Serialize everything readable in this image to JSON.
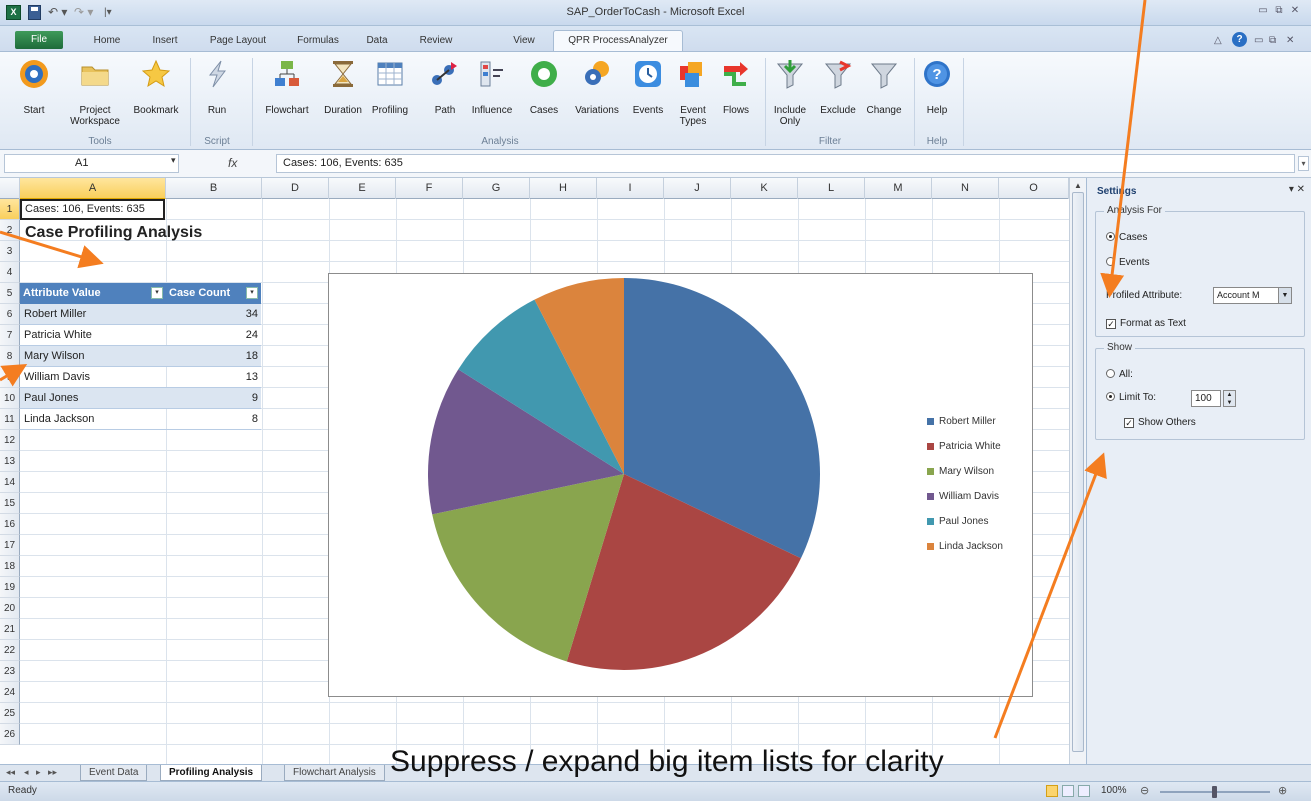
{
  "window": {
    "title": "SAP_OrderToCash - Microsoft Excel",
    "app_icon_glyph": "X"
  },
  "tabs": [
    "File",
    "Home",
    "Insert",
    "Page Layout",
    "Formulas",
    "Data",
    "Review",
    "View",
    "QPR ProcessAnalyzer"
  ],
  "ribbon": {
    "tools": {
      "group": "Tools",
      "buttons": [
        {
          "label": "Start",
          "icon": "start-icon"
        },
        {
          "label": "Project Workspace",
          "icon": "folder-icon"
        },
        {
          "label": "Bookmark",
          "icon": "star-icon"
        }
      ]
    },
    "script": {
      "group": "Script",
      "buttons": [
        {
          "label": "Run",
          "icon": "run-icon"
        }
      ]
    },
    "analysis": {
      "group": "Analysis",
      "buttons": [
        {
          "label": "Flowchart",
          "icon": "flowchart-icon"
        },
        {
          "label": "Duration",
          "icon": "hourglass-icon"
        },
        {
          "label": "Profiling",
          "icon": "table-icon"
        },
        {
          "label": "Path",
          "icon": "path-icon"
        },
        {
          "label": "Influence",
          "icon": "influence-icon"
        },
        {
          "label": "Cases",
          "icon": "cases-icon"
        },
        {
          "label": "Variations",
          "icon": "variations-icon"
        },
        {
          "label": "Events",
          "icon": "clock-icon"
        },
        {
          "label": "Event Types",
          "icon": "event-types-icon"
        },
        {
          "label": "Flows",
          "icon": "flows-icon"
        }
      ]
    },
    "filter": {
      "group": "Filter",
      "buttons": [
        {
          "label": "Include Only",
          "icon": "include-filter-icon"
        },
        {
          "label": "Exclude",
          "icon": "exclude-filter-icon"
        },
        {
          "label": "Change",
          "icon": "change-filter-icon"
        }
      ]
    },
    "help": {
      "group": "Help",
      "buttons": [
        {
          "label": "Help",
          "icon": "help-icon"
        }
      ]
    }
  },
  "formula_bar": {
    "name_box": "A1",
    "fx": "fx",
    "formula": "Cases: 106, Events: 635"
  },
  "columns": [
    "A",
    "B",
    "D",
    "E",
    "F",
    "G",
    "H",
    "I",
    "J",
    "K",
    "L",
    "M",
    "N",
    "O"
  ],
  "rows": [
    "1",
    "2",
    "3",
    "4",
    "5",
    "6",
    "7",
    "8",
    "9",
    "10",
    "11",
    "12",
    "13",
    "14",
    "15",
    "16",
    "17",
    "18",
    "19",
    "20",
    "21",
    "22",
    "23",
    "24",
    "25",
    "26"
  ],
  "sheet": {
    "a1": "Cases: 106, Events: 635",
    "heading": "Case Profiling Analysis",
    "table_headers": [
      "Attribute Value",
      "Case Count"
    ],
    "table_rows": [
      {
        "name": "Robert Miller",
        "count": "34"
      },
      {
        "name": "Patricia White",
        "count": "24"
      },
      {
        "name": "Mary Wilson",
        "count": "18"
      },
      {
        "name": "William Davis",
        "count": "13"
      },
      {
        "name": "Paul Jones",
        "count": "9"
      },
      {
        "name": "Linda Jackson",
        "count": "8"
      }
    ]
  },
  "chart_data": {
    "type": "pie",
    "categories": [
      "Robert Miller",
      "Patricia White",
      "Mary Wilson",
      "William Davis",
      "Paul Jones",
      "Linda Jackson"
    ],
    "values": [
      34,
      24,
      18,
      13,
      9,
      8
    ],
    "colors": [
      "#4572a7",
      "#aa4643",
      "#89a54e",
      "#71588f",
      "#4198af",
      "#db843d"
    ],
    "title": "",
    "legend_position": "right"
  },
  "settings_pane": {
    "title": "Settings",
    "analysis_for": {
      "legend": "Analysis For",
      "cases": "Cases",
      "events": "Events",
      "selected": "Cases"
    },
    "profiled_attribute_label": "Profiled Attribute:",
    "profiled_attribute_value": "Account M",
    "format_as_text": "Format as Text",
    "show": {
      "legend": "Show",
      "all": "All:",
      "limit_to": "Limit To:",
      "limit_value": "100",
      "show_others": "Show Others"
    }
  },
  "sheet_tabs": [
    "Event Data",
    "Profiling Analysis",
    "Flowchart Analysis"
  ],
  "active_sheet": "Profiling Analysis",
  "status": {
    "ready": "Ready",
    "zoom": "100%"
  },
  "annotation": "Suppress / expand big item lists for clarity",
  "colors": {
    "accent": "#4f81bd",
    "arrow": "#f47d20"
  }
}
